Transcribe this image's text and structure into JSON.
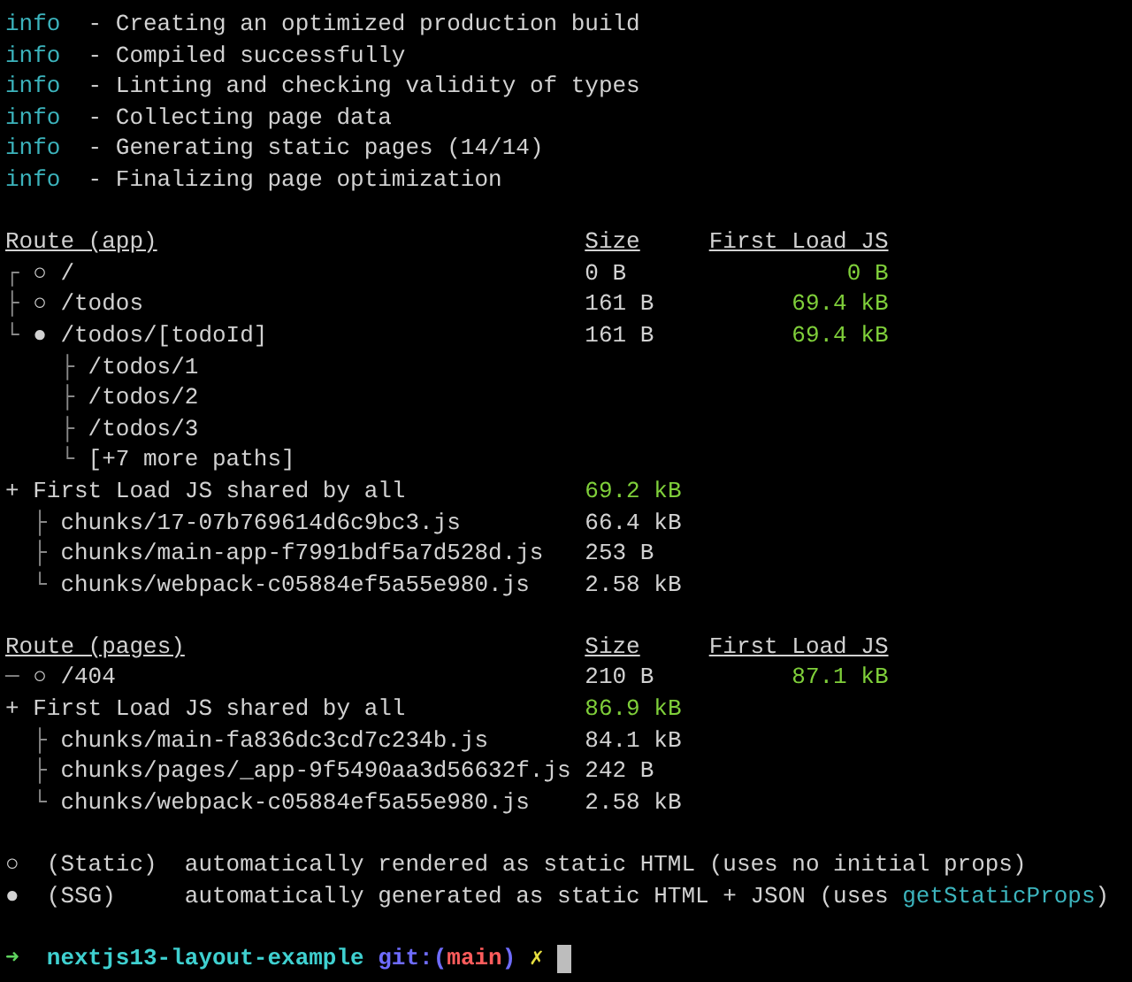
{
  "build_log": [
    {
      "level": "info",
      "message": "- Creating an optimized production build"
    },
    {
      "level": "info",
      "message": "- Compiled successfully"
    },
    {
      "level": "info",
      "message": "- Linting and checking validity of types"
    },
    {
      "level": "info",
      "message": "- Collecting page data"
    },
    {
      "level": "info",
      "message": "- Generating static pages (14/14)"
    },
    {
      "level": "info",
      "message": "- Finalizing page optimization"
    }
  ],
  "route_tables": [
    {
      "heading": "Route (app)",
      "size_heading": "Size",
      "first_load_heading": "First Load JS",
      "routes": [
        {
          "branch": "┌",
          "symbol": "○",
          "path": "/",
          "size": "0 B",
          "first_load": "0 B"
        },
        {
          "branch": "├",
          "symbol": "○",
          "path": "/todos",
          "size": "161 B",
          "first_load": "69.4 kB"
        },
        {
          "branch": "└",
          "symbol": "●",
          "path": "/todos/[todoId]",
          "size": "161 B",
          "first_load": "69.4 kB",
          "children": [
            {
              "branch": "├",
              "path": "/todos/1"
            },
            {
              "branch": "├",
              "path": "/todos/2"
            },
            {
              "branch": "├",
              "path": "/todos/3"
            },
            {
              "branch": "└",
              "path": "[+7 more paths]"
            }
          ]
        }
      ],
      "shared": {
        "marker": "+",
        "label": "First Load JS shared by all",
        "size": "69.2 kB",
        "chunks": [
          {
            "branch": "├",
            "name": "chunks/17-07b769614d6c9bc3.js",
            "size": "66.4 kB"
          },
          {
            "branch": "├",
            "name": "chunks/main-app-f7991bdf5a7d528d.js",
            "size": "253 B"
          },
          {
            "branch": "└",
            "name": "chunks/webpack-c05884ef5a55e980.js",
            "size": "2.58 kB"
          }
        ]
      }
    },
    {
      "heading": "Route (pages)",
      "size_heading": "Size",
      "first_load_heading": "First Load JS",
      "routes": [
        {
          "branch": "─",
          "symbol": "○",
          "path": "/404",
          "size": "210 B",
          "first_load": "87.1 kB"
        }
      ],
      "shared": {
        "marker": "+",
        "label": "First Load JS shared by all",
        "size": "86.9 kB",
        "chunks": [
          {
            "branch": "├",
            "name": "chunks/main-fa836dc3cd7c234b.js",
            "size": "84.1 kB"
          },
          {
            "branch": "├",
            "name": "chunks/pages/_app-9f5490aa3d56632f.js",
            "size": "242 B"
          },
          {
            "branch": "└",
            "name": "chunks/webpack-c05884ef5a55e980.js",
            "size": "2.58 kB"
          }
        ]
      }
    }
  ],
  "legend": [
    {
      "symbol": "○",
      "name": "(Static)",
      "description": [
        {
          "text": "automatically rendered as static HTML (uses no initial props)",
          "highlight": false
        }
      ]
    },
    {
      "symbol": "●",
      "name": "(SSG)",
      "description": [
        {
          "text": "automatically generated as static HTML + JSON (uses ",
          "highlight": false
        },
        {
          "text": "getStaticProps",
          "highlight": true
        },
        {
          "text": ")",
          "highlight": false
        }
      ]
    }
  ],
  "prompt": {
    "arrow": "➜",
    "directory": "nextjs13-layout-example",
    "git_open": "git:(",
    "branch": "main",
    "git_close": ")",
    "dirty_mark": "✗"
  }
}
